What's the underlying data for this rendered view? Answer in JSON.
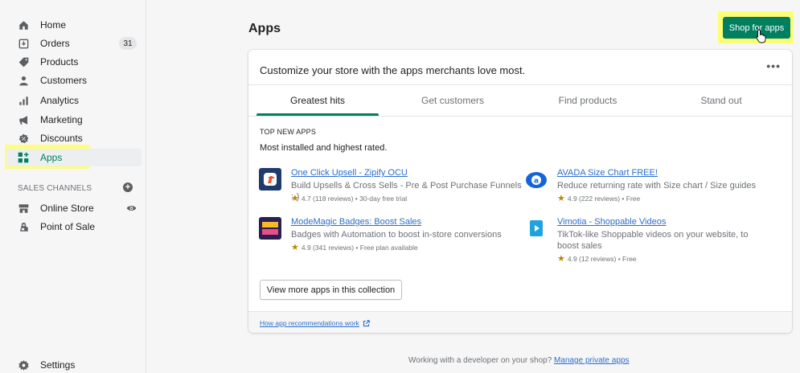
{
  "sidebar": {
    "items": [
      {
        "label": "Home",
        "icon": "home-icon"
      },
      {
        "label": "Orders",
        "icon": "orders-icon",
        "badge": "31"
      },
      {
        "label": "Products",
        "icon": "tag-icon"
      },
      {
        "label": "Customers",
        "icon": "person-icon"
      },
      {
        "label": "Analytics",
        "icon": "bar-chart-icon"
      },
      {
        "label": "Marketing",
        "icon": "megaphone-icon"
      },
      {
        "label": "Discounts",
        "icon": "discount-icon"
      },
      {
        "label": "Apps",
        "icon": "apps-icon"
      }
    ],
    "sales_channels_title": "SALES CHANNELS",
    "channels": [
      {
        "label": "Online Store",
        "icon": "store-icon"
      },
      {
        "label": "Point of Sale",
        "icon": "pos-icon"
      }
    ],
    "settings_label": "Settings"
  },
  "main": {
    "title": "Apps",
    "shop_button": "Shop for apps",
    "card": {
      "heading": "Customize your store with the apps merchants love most.",
      "more": "•••",
      "tabs": [
        "Greatest hits",
        "Get customers",
        "Find products",
        "Stand out"
      ],
      "section_title": "TOP NEW APPS",
      "section_sub": "Most installed and highest rated.",
      "apps": [
        {
          "name": "One Click Upsell - Zipify OCU",
          "desc": "Build Upsells & Cross Sells - Pre & Post Purchase Funnels :-)",
          "rating": "4.7 (118 reviews) • 30-day free trial"
        },
        {
          "name": "AVADA Size Chart FREE!",
          "desc": "Reduce returning rate with Size chart / Size guides",
          "rating": "4.9 (222 reviews) • Free"
        },
        {
          "name": "ModeMagic Badges: Boost Sales",
          "desc": "Badges with Automation to boost in-store conversions",
          "rating": "4.9 (341 reviews) • Free plan available"
        },
        {
          "name": "Vimotia - Shoppable Videos",
          "desc": "TikTok-like Shoppable videos on your website, to boost sales",
          "rating": "4.9 (12 reviews) • Free"
        }
      ],
      "view_more": "View more apps in this collection",
      "footer_link": "How app recommendations work"
    },
    "bottom_text": "Working with a developer on your shop?",
    "bottom_link": "Manage private apps"
  },
  "colors": {
    "accent": "#008060",
    "link": "#2c6ecb",
    "highlight": "#ffff66"
  }
}
